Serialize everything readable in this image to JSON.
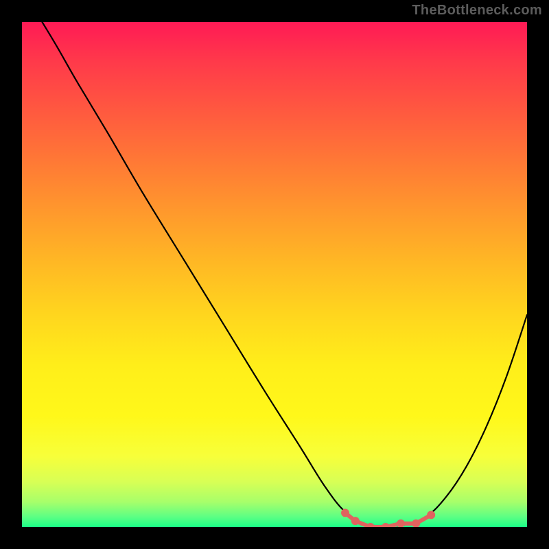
{
  "watermark": "TheBottleneck.com",
  "chart_data": {
    "type": "line",
    "title": "",
    "xlabel": "",
    "ylabel": "",
    "xlim": [
      0,
      100
    ],
    "ylim": [
      0,
      100
    ],
    "grid": false,
    "series": [
      {
        "name": "curve",
        "color": "#000000",
        "points": [
          [
            4,
            100
          ],
          [
            7,
            95
          ],
          [
            11,
            88
          ],
          [
            17,
            78
          ],
          [
            24,
            66
          ],
          [
            32,
            53
          ],
          [
            40,
            40
          ],
          [
            48,
            27
          ],
          [
            55,
            16
          ],
          [
            60,
            8
          ],
          [
            64,
            3
          ],
          [
            68,
            0.6
          ],
          [
            72,
            0.2
          ],
          [
            76,
            0.5
          ],
          [
            80,
            2
          ],
          [
            84,
            6
          ],
          [
            88,
            12
          ],
          [
            92,
            20
          ],
          [
            96,
            30
          ],
          [
            100,
            42
          ]
        ]
      }
    ],
    "highlight": {
      "name": "minimum-region",
      "color": "#e0635f",
      "points": [
        [
          64,
          2.8
        ],
        [
          66,
          1.2
        ],
        [
          69,
          0.0
        ],
        [
          72,
          0.0
        ],
        [
          75,
          0.7
        ],
        [
          78,
          0.7
        ],
        [
          81,
          2.4
        ]
      ]
    },
    "gradient_stops": [
      {
        "pos": 0,
        "color": "#ff1a55"
      },
      {
        "pos": 50,
        "color": "#ffd61e"
      },
      {
        "pos": 100,
        "color": "#1aff87"
      }
    ]
  }
}
